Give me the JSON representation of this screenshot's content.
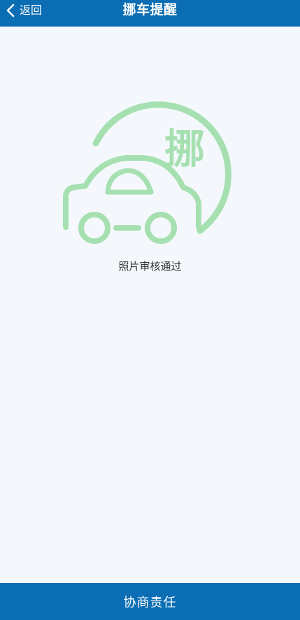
{
  "header": {
    "back_label": "返回",
    "title": "挪车提醒"
  },
  "main": {
    "illustration_badge_text": "挪",
    "illustration_icon": "car-with-circle-icon",
    "status_text": "照片审核通过"
  },
  "footer": {
    "action_label": "协商责任"
  },
  "colors": {
    "header_bg": "#0b6db3",
    "page_bg": "#f4f8fc",
    "illustration_green": "#a6e0b1"
  }
}
